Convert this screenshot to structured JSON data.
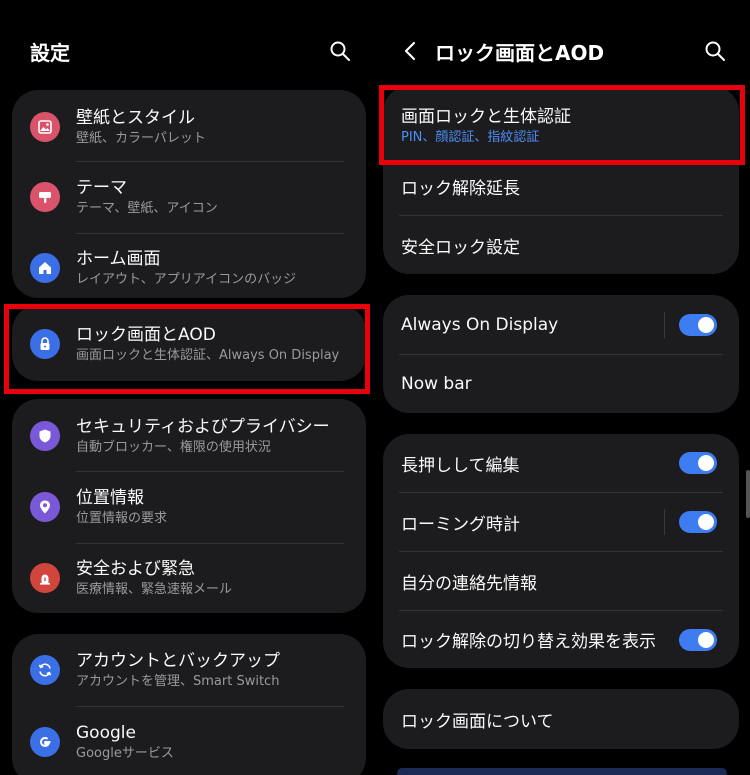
{
  "left": {
    "title": "設定",
    "groups": [
      {
        "items": [
          {
            "title": "壁紙とスタイル",
            "subtitle": "壁紙、カラーパレット",
            "icon": "wallpaper-icon",
            "color": "#d9536a"
          },
          {
            "title": "テーマ",
            "subtitle": "テーマ、壁紙、アイコン",
            "icon": "theme-brush-icon",
            "color": "#d9536a"
          },
          {
            "title": "ホーム画面",
            "subtitle": "レイアウト、アプリアイコンのバッジ",
            "icon": "home-icon",
            "color": "#3b6fe6"
          }
        ]
      },
      {
        "items": [
          {
            "title": "ロック画面とAOD",
            "subtitle": "画面ロックと生体認証、Always On Display",
            "icon": "lock-icon",
            "color": "#3b6fe6"
          }
        ]
      },
      {
        "items": [
          {
            "title": "セキュリティおよびプライバシー",
            "subtitle": "自動ブロッカー、権限の使用状況",
            "icon": "shield-icon",
            "color": "#7a59d9"
          },
          {
            "title": "位置情報",
            "subtitle": "位置情報の要求",
            "icon": "location-pin-icon",
            "color": "#7a59d9"
          },
          {
            "title": "安全および緊急",
            "subtitle": "医療情報、緊急速報メール",
            "icon": "emergency-icon",
            "color": "#d0453c"
          }
        ]
      },
      {
        "items": [
          {
            "title": "アカウントとバックアップ",
            "subtitle": "アカウントを管理、Smart Switch",
            "icon": "sync-icon",
            "color": "#3b6fe6"
          },
          {
            "title": "Google",
            "subtitle": "Googleサービス",
            "icon": "google-icon",
            "color": "#3b6fe6"
          }
        ]
      }
    ]
  },
  "right": {
    "title": "ロック画面とAOD",
    "groups": [
      {
        "items": [
          {
            "title": "画面ロックと生体認証",
            "subtitle": "PIN、顔認証、指紋認証"
          },
          {
            "title": "ロック解除延長"
          },
          {
            "title": "安全ロック設定"
          }
        ]
      },
      {
        "items": [
          {
            "title": "Always On Display",
            "toggle": true
          },
          {
            "title": "Now bar"
          }
        ]
      },
      {
        "items": [
          {
            "title": "長押しして編集",
            "toggle": true
          },
          {
            "title": "ローミング時計",
            "toggle": true
          },
          {
            "title": "自分の連絡先情報"
          },
          {
            "title": "ロック解除の切り替え効果を表示",
            "toggle": true
          }
        ]
      },
      {
        "items": [
          {
            "title": "ロック画面について"
          }
        ]
      }
    ]
  },
  "colors": {
    "highlight": "#e8000a",
    "toggle_on": "#3e7cf2",
    "card": "#1c1c1e",
    "subtitle_accent": "#4c8ef7"
  }
}
